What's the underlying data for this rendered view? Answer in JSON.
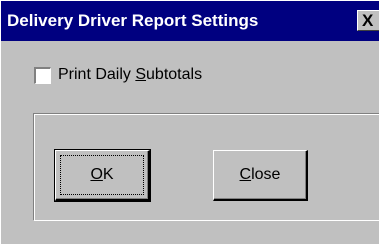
{
  "window": {
    "title": "Delivery Driver Report Settings",
    "close_glyph": "X"
  },
  "options": {
    "print_daily_subtotals": {
      "label_prefix": "Print Daily ",
      "label_mnemonic": "S",
      "label_suffix": "ubtotals",
      "checked": false
    }
  },
  "buttons": {
    "ok": {
      "mnemonic": "O",
      "rest": "K"
    },
    "close": {
      "mnemonic": "C",
      "rest": "lose"
    }
  },
  "colors": {
    "titlebar": "#000080",
    "face": "#c0c0c0"
  }
}
